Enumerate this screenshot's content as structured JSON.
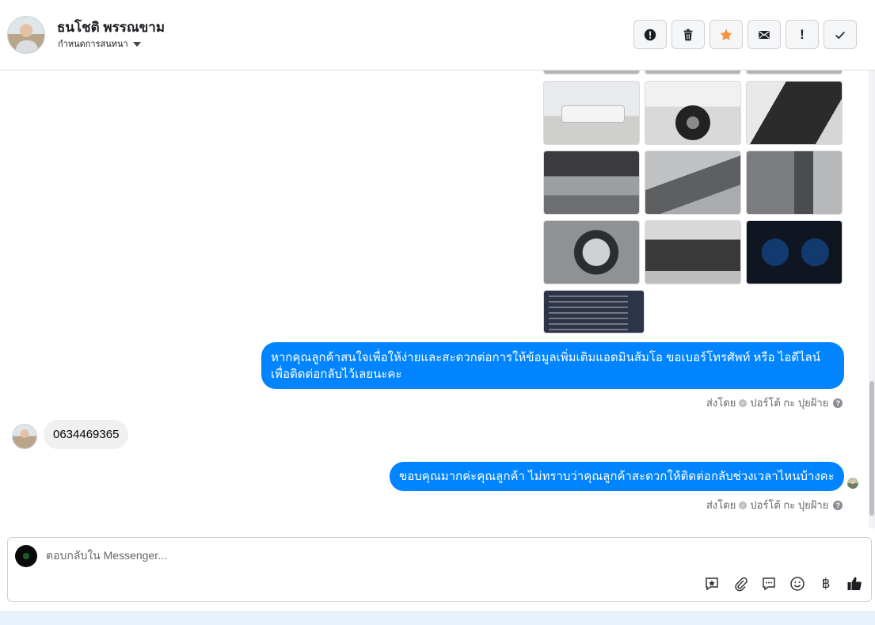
{
  "header": {
    "name": "ธนโชติ พรรณขาม",
    "subtitle": "กำหนดการสนทนา",
    "actions": [
      {
        "icon": "alert-circle-icon"
      },
      {
        "icon": "trash-icon"
      },
      {
        "icon": "star-icon",
        "color": "#f7923b"
      },
      {
        "icon": "envelope-icon"
      },
      {
        "icon": "exclamation-icon",
        "label": "!"
      },
      {
        "icon": "check-icon"
      }
    ]
  },
  "messages": [
    {
      "direction": "outgoing",
      "text_line1": "หากคุณลูกค้าสนใจเพื่อให้ง่ายและสะดวกต่อการให้ข้อมูลเพิ่มเติมแอดมินส้มโอ ขอเบอร์โทรศัพท์ หรือ ไอดีไลน์",
      "text_line2": "เพื่อติดต่อกลับไว้เลยนะคะ",
      "sent_by": "ส่งโดย",
      "agent": "ปอร์โต้ กะ ปุยฝ้าย"
    },
    {
      "direction": "incoming",
      "text": "0634469365"
    },
    {
      "direction": "outgoing",
      "text": "ขอบคุณมากค่ะคุณลูกค้า ไม่ทราบว่าคุณลูกค้าสะดวกให้ติดต่อกลับช่วงเวลาไหนบ้างคะ",
      "sent_by": "ส่งโดย",
      "agent": "ปอร์โต้ กะ ปุยฝ้าย"
    }
  ],
  "composer": {
    "placeholder": "ตอบกลับใน Messenger...",
    "tools": [
      "sticker-star-icon",
      "paperclip-icon",
      "saved-reply-icon",
      "emoji-icon",
      "baht-icon",
      "thumbs-up-icon"
    ],
    "baht_glyph": "฿"
  },
  "colors": {
    "outgoing_bubble": "#0084ff",
    "incoming_bubble": "#f0f0f0",
    "accent_star": "#f7923b"
  }
}
